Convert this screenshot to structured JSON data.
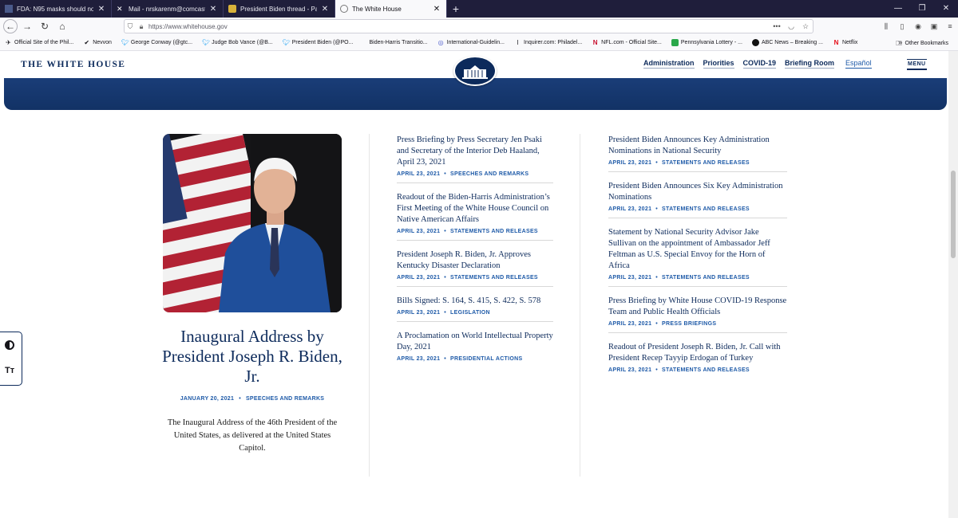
{
  "browser": {
    "tabs": [
      {
        "title": "FDA: N95 masks should no lon",
        "active": false
      },
      {
        "title": "Mail - nrskarenm@comcast.ne",
        "active": false
      },
      {
        "title": "President Biden thread - Page",
        "active": false
      },
      {
        "title": "The White House",
        "active": true
      }
    ],
    "url": "https://www.whitehouse.gov",
    "bookmarks": [
      "Official Site of the Phil...",
      "Nevvon",
      "George Conway (@gtc...",
      "Judge Bob Vance (@B...",
      "President Biden (@PO...",
      "Biden-Harris Transitio...",
      "International-Guidelin...",
      "Inquirer.com: Philadel...",
      "NFL.com - Official Site...",
      "Pennsylvania Lottery - ...",
      "ABC News – Breaking ...",
      "Netflix"
    ],
    "other_bookmarks": "Other Bookmarks"
  },
  "site": {
    "brand": "THE WHITE HOUSE",
    "nav": [
      "Administration",
      "Priorities",
      "COVID-19",
      "Briefing Room"
    ],
    "nav_lang": "Español",
    "menu": "MENU"
  },
  "feature": {
    "title": "Inaugural Address by President Joseph R. Biden, Jr.",
    "date": "JANUARY 20, 2021",
    "category": "SPEECHES AND REMARKS",
    "description": "The Inaugural Address of the 46th President of the United States, as delivered at the United States Capitol."
  },
  "column_middle": [
    {
      "title": "Press Briefing by Press Secretary Jen Psaki and Secretary of the Interior Deb Haaland, April 23, 2021",
      "date": "APRIL 23, 2021",
      "category": "SPEECHES AND REMARKS"
    },
    {
      "title": "Readout of the Biden-Harris Administration’s First Meeting of the White House Council on Native American Affairs",
      "date": "APRIL 23, 2021",
      "category": "STATEMENTS AND RELEASES"
    },
    {
      "title": "President Joseph R. Biden, Jr. Approves Kentucky Disaster Declaration",
      "date": "APRIL 23, 2021",
      "category": "STATEMENTS AND RELEASES"
    },
    {
      "title": "Bills Signed: S. 164, S. 415, S. 422, S. 578",
      "date": "APRIL 23, 2021",
      "category": "LEGISLATION"
    },
    {
      "title": "A Proclamation on World Intellectual Property Day, 2021",
      "date": "APRIL 23, 2021",
      "category": "PRESIDENTIAL ACTIONS"
    }
  ],
  "column_right": [
    {
      "title": "President Biden Announces Key Administration Nominations in National Security",
      "date": "APRIL 23, 2021",
      "category": "STATEMENTS AND RELEASES"
    },
    {
      "title": "President Biden Announces Six Key Administration Nominations",
      "date": "APRIL 23, 2021",
      "category": "STATEMENTS AND RELEASES"
    },
    {
      "title": "Statement by National Security Advisor Jake Sullivan on the appointment of Ambassador Jeff Feltman as U.S. Special Envoy for the Horn of Africa",
      "date": "APRIL 23, 2021",
      "category": "STATEMENTS AND RELEASES"
    },
    {
      "title": "Press Briefing by White House COVID-19 Response Team and Public Health Officials",
      "date": "APRIL 23, 2021",
      "category": "PRESS BRIEFINGS"
    },
    {
      "title": "Readout of President Joseph R. Biden, Jr. Call with President Recep Tayyip Erdogan of Turkey",
      "date": "APRIL 23, 2021",
      "category": "STATEMENTS AND RELEASES"
    }
  ],
  "accessibility": {
    "text_size_label": "Tт"
  },
  "colors": {
    "navy": "#0c2a5b",
    "link_blue": "#1e5aa8",
    "tabbar": "#1f1e3b"
  }
}
